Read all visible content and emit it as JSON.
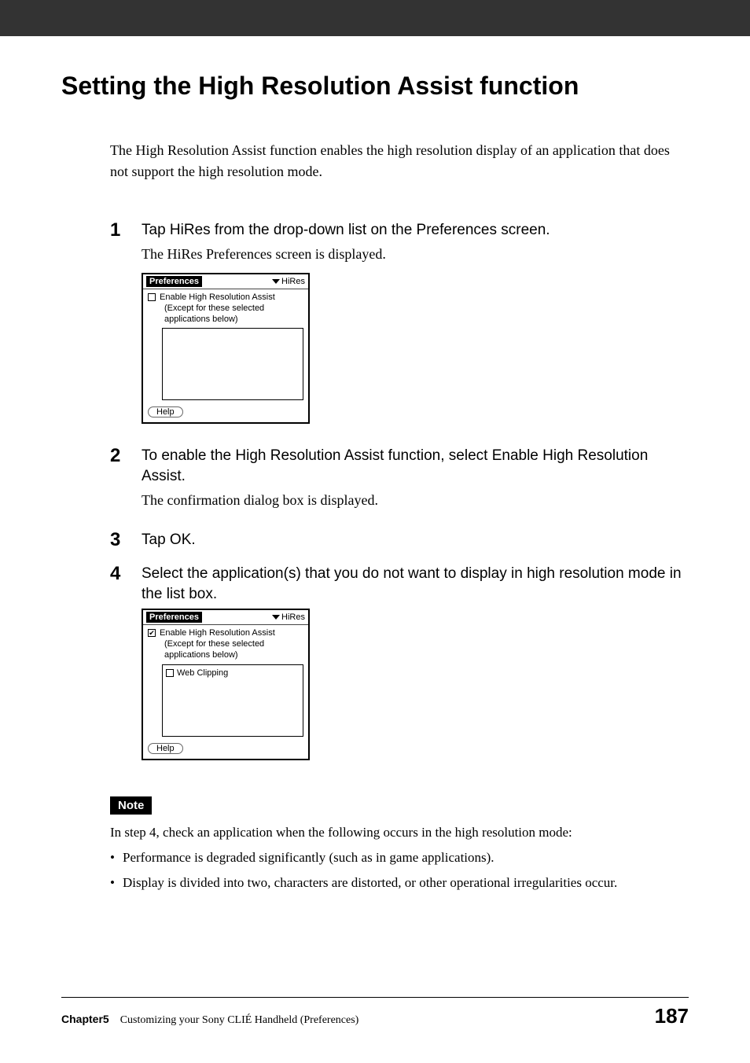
{
  "title": "Setting the High Resolution Assist function",
  "intro": "The High Resolution Assist function enables the high resolution display of an application that does not support the high resolution mode.",
  "steps": [
    {
      "num": "1",
      "title": "Tap HiRes from the drop-down list on the Preferences screen.",
      "desc": "The HiRes Preferences screen is displayed."
    },
    {
      "num": "2",
      "title": "To enable the High Resolution Assist function, select Enable High Resolution Assist.",
      "desc": "The confirmation dialog box is displayed."
    },
    {
      "num": "3",
      "title": "Tap OK."
    },
    {
      "num": "4",
      "title": "Select the application(s) that you do not want to display in high resolution mode in the list box."
    }
  ],
  "screenshot": {
    "header_title": "Preferences",
    "header_menu": "HiRes",
    "checkbox_label": "Enable High Resolution Assist",
    "checkbox_sub": "(Except for these selected applications below)",
    "help": "Help",
    "list_item": "Web Clipping"
  },
  "note": {
    "label": "Note",
    "intro": "In step 4, check an application when the following occurs in the high resolution mode:",
    "bullets": [
      "Performance is degraded significantly (such as in game applications).",
      "Display is divided into two, characters are distorted, or other operational irregularities occur."
    ]
  },
  "footer": {
    "chapter": "Chapter5",
    "subtitle": "Customizing your Sony CLIÉ Handheld (Preferences)",
    "page": "187"
  }
}
